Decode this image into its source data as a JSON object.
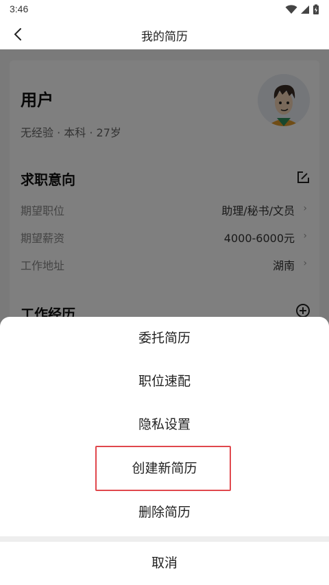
{
  "status_bar": {
    "time": "3:46"
  },
  "nav": {
    "title": "我的简历"
  },
  "profile": {
    "name": "用户",
    "meta": "无经验 · 本科 · 27岁"
  },
  "intent": {
    "title": "求职意向",
    "rows": [
      {
        "label": "期望职位",
        "value": "助理/秘书/文员"
      },
      {
        "label": "期望薪资",
        "value": "4000-6000元"
      },
      {
        "label": "工作地址",
        "value": "湖南"
      }
    ]
  },
  "experience": {
    "title": "工作经历"
  },
  "action_sheet": {
    "items": [
      "委托简历",
      "职位速配",
      "隐私设置",
      "创建新简历",
      "删除简历"
    ],
    "cancel": "取消"
  },
  "colors": {
    "highlight": "#e0474c",
    "overlay": "rgba(0,0,0,0.5)"
  }
}
